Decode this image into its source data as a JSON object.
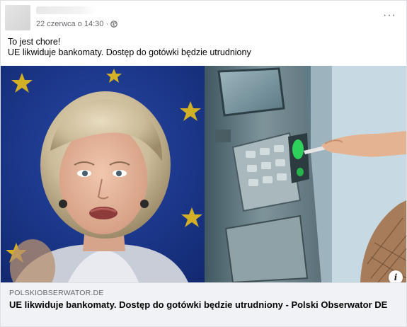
{
  "post": {
    "author_name": "",
    "timestamp": "22 czerwca o 14:30 ·",
    "privacy_icon": "globe-icon",
    "more_options_icon": "ellipsis-icon",
    "more_options_glyph": "···",
    "text_lines": [
      "To jest chore!",
      "UE likwiduje bankomaty. Dostęp do gotówki będzie utrudniony"
    ]
  },
  "media": {
    "left_image": "woman-speaking-photo",
    "right_image": "atm-card-insertion-photo",
    "info_label": "i"
  },
  "link_preview": {
    "domain": "POLSKIOBSERWATOR.DE",
    "title": "UE likwiduje bankomaty. Dostęp do gotówki będzie utrudniony - Polski Obserwator DE"
  },
  "colors": {
    "eu_blue": "#1c3a93",
    "eu_star": "#f3c614",
    "secondary_text": "#65676b",
    "link_bg": "#f0f2f5"
  }
}
